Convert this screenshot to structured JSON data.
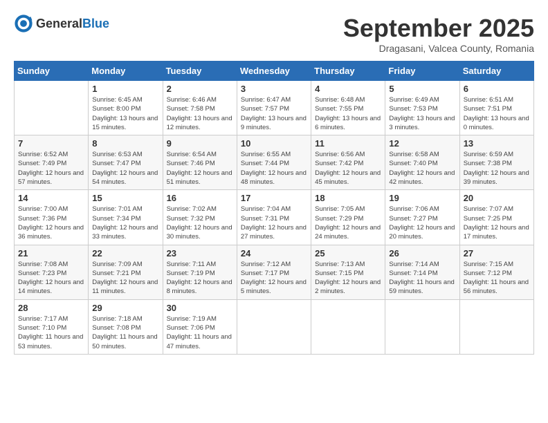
{
  "header": {
    "logo_general": "General",
    "logo_blue": "Blue",
    "month_year": "September 2025",
    "location": "Dragasani, Valcea County, Romania"
  },
  "weekdays": [
    "Sunday",
    "Monday",
    "Tuesday",
    "Wednesday",
    "Thursday",
    "Friday",
    "Saturday"
  ],
  "weeks": [
    [
      {
        "day": "",
        "info": ""
      },
      {
        "day": "1",
        "info": "Sunrise: 6:45 AM\nSunset: 8:00 PM\nDaylight: 13 hours\nand 15 minutes."
      },
      {
        "day": "2",
        "info": "Sunrise: 6:46 AM\nSunset: 7:58 PM\nDaylight: 13 hours\nand 12 minutes."
      },
      {
        "day": "3",
        "info": "Sunrise: 6:47 AM\nSunset: 7:57 PM\nDaylight: 13 hours\nand 9 minutes."
      },
      {
        "day": "4",
        "info": "Sunrise: 6:48 AM\nSunset: 7:55 PM\nDaylight: 13 hours\nand 6 minutes."
      },
      {
        "day": "5",
        "info": "Sunrise: 6:49 AM\nSunset: 7:53 PM\nDaylight: 13 hours\nand 3 minutes."
      },
      {
        "day": "6",
        "info": "Sunrise: 6:51 AM\nSunset: 7:51 PM\nDaylight: 13 hours\nand 0 minutes."
      }
    ],
    [
      {
        "day": "7",
        "info": "Sunrise: 6:52 AM\nSunset: 7:49 PM\nDaylight: 12 hours\nand 57 minutes."
      },
      {
        "day": "8",
        "info": "Sunrise: 6:53 AM\nSunset: 7:47 PM\nDaylight: 12 hours\nand 54 minutes."
      },
      {
        "day": "9",
        "info": "Sunrise: 6:54 AM\nSunset: 7:46 PM\nDaylight: 12 hours\nand 51 minutes."
      },
      {
        "day": "10",
        "info": "Sunrise: 6:55 AM\nSunset: 7:44 PM\nDaylight: 12 hours\nand 48 minutes."
      },
      {
        "day": "11",
        "info": "Sunrise: 6:56 AM\nSunset: 7:42 PM\nDaylight: 12 hours\nand 45 minutes."
      },
      {
        "day": "12",
        "info": "Sunrise: 6:58 AM\nSunset: 7:40 PM\nDaylight: 12 hours\nand 42 minutes."
      },
      {
        "day": "13",
        "info": "Sunrise: 6:59 AM\nSunset: 7:38 PM\nDaylight: 12 hours\nand 39 minutes."
      }
    ],
    [
      {
        "day": "14",
        "info": "Sunrise: 7:00 AM\nSunset: 7:36 PM\nDaylight: 12 hours\nand 36 minutes."
      },
      {
        "day": "15",
        "info": "Sunrise: 7:01 AM\nSunset: 7:34 PM\nDaylight: 12 hours\nand 33 minutes."
      },
      {
        "day": "16",
        "info": "Sunrise: 7:02 AM\nSunset: 7:32 PM\nDaylight: 12 hours\nand 30 minutes."
      },
      {
        "day": "17",
        "info": "Sunrise: 7:04 AM\nSunset: 7:31 PM\nDaylight: 12 hours\nand 27 minutes."
      },
      {
        "day": "18",
        "info": "Sunrise: 7:05 AM\nSunset: 7:29 PM\nDaylight: 12 hours\nand 24 minutes."
      },
      {
        "day": "19",
        "info": "Sunrise: 7:06 AM\nSunset: 7:27 PM\nDaylight: 12 hours\nand 20 minutes."
      },
      {
        "day": "20",
        "info": "Sunrise: 7:07 AM\nSunset: 7:25 PM\nDaylight: 12 hours\nand 17 minutes."
      }
    ],
    [
      {
        "day": "21",
        "info": "Sunrise: 7:08 AM\nSunset: 7:23 PM\nDaylight: 12 hours\nand 14 minutes."
      },
      {
        "day": "22",
        "info": "Sunrise: 7:09 AM\nSunset: 7:21 PM\nDaylight: 12 hours\nand 11 minutes."
      },
      {
        "day": "23",
        "info": "Sunrise: 7:11 AM\nSunset: 7:19 PM\nDaylight: 12 hours\nand 8 minutes."
      },
      {
        "day": "24",
        "info": "Sunrise: 7:12 AM\nSunset: 7:17 PM\nDaylight: 12 hours\nand 5 minutes."
      },
      {
        "day": "25",
        "info": "Sunrise: 7:13 AM\nSunset: 7:15 PM\nDaylight: 12 hours\nand 2 minutes."
      },
      {
        "day": "26",
        "info": "Sunrise: 7:14 AM\nSunset: 7:14 PM\nDaylight: 11 hours\nand 59 minutes."
      },
      {
        "day": "27",
        "info": "Sunrise: 7:15 AM\nSunset: 7:12 PM\nDaylight: 11 hours\nand 56 minutes."
      }
    ],
    [
      {
        "day": "28",
        "info": "Sunrise: 7:17 AM\nSunset: 7:10 PM\nDaylight: 11 hours\nand 53 minutes."
      },
      {
        "day": "29",
        "info": "Sunrise: 7:18 AM\nSunset: 7:08 PM\nDaylight: 11 hours\nand 50 minutes."
      },
      {
        "day": "30",
        "info": "Sunrise: 7:19 AM\nSunset: 7:06 PM\nDaylight: 11 hours\nand 47 minutes."
      },
      {
        "day": "",
        "info": ""
      },
      {
        "day": "",
        "info": ""
      },
      {
        "day": "",
        "info": ""
      },
      {
        "day": "",
        "info": ""
      }
    ]
  ]
}
